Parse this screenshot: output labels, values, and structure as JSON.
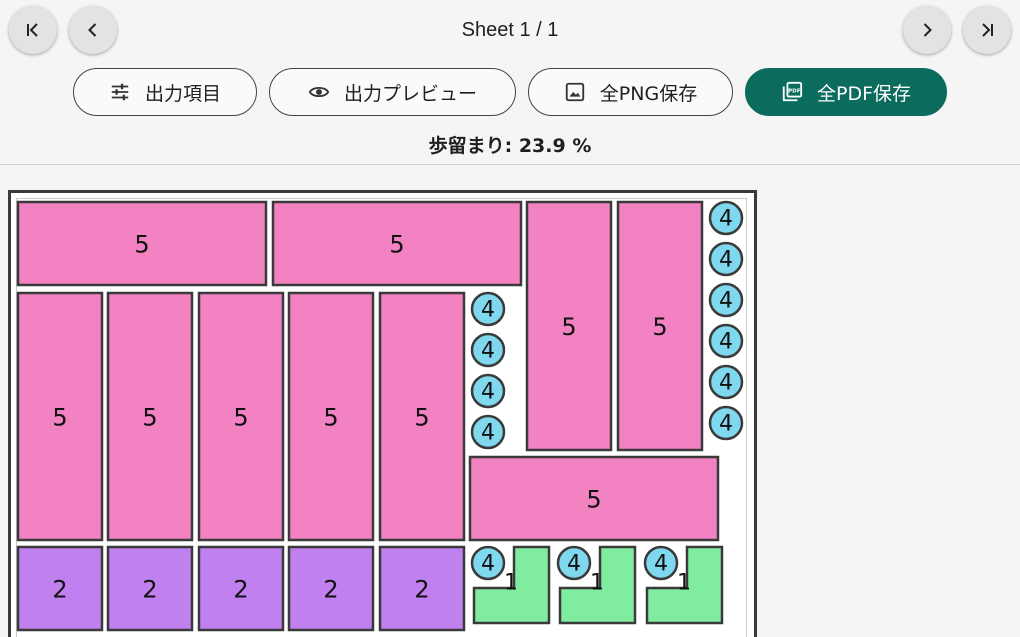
{
  "header": {
    "sheet_label": "Sheet 1 / 1",
    "nav": {
      "first_icon": "first-page-icon",
      "prev_icon": "chevron-left-icon",
      "next_icon": "chevron-right-icon",
      "last_icon": "last-page-icon"
    }
  },
  "toolbar": {
    "output_items_label": "出力項目",
    "output_items_icon": "tune-icon",
    "preview_label": "出力プレビュー",
    "preview_icon": "eye-icon",
    "save_png_label": "全PNG保存",
    "save_png_icon": "image-icon",
    "save_pdf_label": "全PDF保存",
    "save_pdf_icon": "pdf-icon"
  },
  "summary": {
    "yield_label": "歩留まり: 23.9 %"
  },
  "colors": {
    "primary": "#0b6b5c",
    "part5": "#f282c2",
    "part2": "#c080f0",
    "part1": "#80eca0",
    "part4": "#80d8ee"
  },
  "sheet": {
    "parts": [
      {
        "kind": "rect",
        "label": "5",
        "color": "#f282c2"
      },
      {
        "kind": "rect",
        "label": "5",
        "color": "#f282c2"
      },
      {
        "kind": "rect",
        "label": "5",
        "color": "#f282c2"
      },
      {
        "kind": "rect",
        "label": "5",
        "color": "#f282c2"
      },
      {
        "kind": "rect",
        "label": "5",
        "color": "#f282c2"
      },
      {
        "kind": "rect",
        "label": "5",
        "color": "#f282c2"
      },
      {
        "kind": "rect",
        "label": "5",
        "color": "#f282c2"
      },
      {
        "kind": "rect",
        "label": "5",
        "color": "#f282c2"
      },
      {
        "kind": "rect",
        "label": "5",
        "color": "#f282c2"
      },
      {
        "kind": "rect",
        "label": "5",
        "color": "#f282c2"
      },
      {
        "kind": "rect",
        "label": "2",
        "color": "#c080f0"
      },
      {
        "kind": "rect",
        "label": "2",
        "color": "#c080f0"
      },
      {
        "kind": "rect",
        "label": "2",
        "color": "#c080f0"
      },
      {
        "kind": "rect",
        "label": "2",
        "color": "#c080f0"
      },
      {
        "kind": "rect",
        "label": "2",
        "color": "#c080f0"
      },
      {
        "kind": "lshape",
        "label": "1",
        "color": "#80eca0"
      },
      {
        "kind": "lshape",
        "label": "1",
        "color": "#80eca0"
      },
      {
        "kind": "lshape",
        "label": "1",
        "color": "#80eca0"
      },
      {
        "kind": "circle",
        "label": "4",
        "color": "#80d8ee"
      },
      {
        "kind": "circle",
        "label": "4",
        "color": "#80d8ee"
      },
      {
        "kind": "circle",
        "label": "4",
        "color": "#80d8ee"
      },
      {
        "kind": "circle",
        "label": "4",
        "color": "#80d8ee"
      },
      {
        "kind": "circle",
        "label": "4",
        "color": "#80d8ee"
      },
      {
        "kind": "circle",
        "label": "4",
        "color": "#80d8ee"
      },
      {
        "kind": "circle",
        "label": "4",
        "color": "#80d8ee"
      },
      {
        "kind": "circle",
        "label": "4",
        "color": "#80d8ee"
      },
      {
        "kind": "circle",
        "label": "4",
        "color": "#80d8ee"
      },
      {
        "kind": "circle",
        "label": "4",
        "color": "#80d8ee"
      },
      {
        "kind": "circle",
        "label": "4",
        "color": "#80d8ee"
      },
      {
        "kind": "circle",
        "label": "4",
        "color": "#80d8ee"
      },
      {
        "kind": "circle",
        "label": "4",
        "color": "#80d8ee"
      }
    ]
  }
}
